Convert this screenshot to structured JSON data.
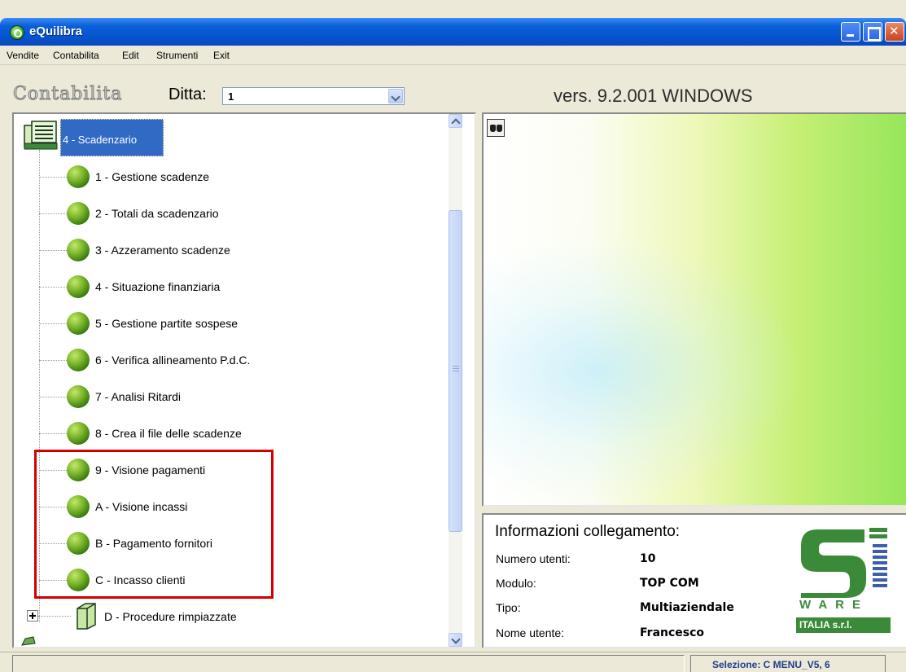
{
  "window": {
    "title": "eQuilibra"
  },
  "menu": [
    {
      "label": "Vendite"
    },
    {
      "label": "Contabilita"
    },
    {
      "label": "Edit"
    },
    {
      "label": "Strumenti"
    },
    {
      "label": "Exit"
    }
  ],
  "header": {
    "module_title": "Contabilita",
    "ditta_label": "Ditta:",
    "ditta_value": "1",
    "version": "vers. 9.2.001 WINDOWS"
  },
  "tree": {
    "root": {
      "label": "4 - Scadenzario",
      "icon": "menu-folder-icon"
    },
    "items": [
      {
        "label": "1 - Gestione scadenze"
      },
      {
        "label": "2 - Totali da scadenzario"
      },
      {
        "label": "3 - Azzeramento scadenze"
      },
      {
        "label": "4 - Situazione finanziaria"
      },
      {
        "label": "5 - Gestione partite sospese"
      },
      {
        "label": "6 - Verifica allineamento P.d.C."
      },
      {
        "label": "7 - Analisi Ritardi"
      },
      {
        "label": "8 - Crea il file delle scadenze"
      },
      {
        "label": "9 - Visione pagamenti"
      },
      {
        "label": "A - Visione incassi"
      },
      {
        "label": "B - Pagamento fornitori"
      },
      {
        "label": "C - Incasso clienti"
      }
    ],
    "subfolder": {
      "label": "D - Procedure rimpiazzate"
    }
  },
  "info": {
    "title": "Informazioni collegamento:",
    "rows": [
      {
        "label": "Numero utenti:",
        "value": "10"
      },
      {
        "label": "Modulo:",
        "value": "TOP COM"
      },
      {
        "label": "Tipo:",
        "value": "Multiaziendale"
      },
      {
        "label": "Nome utente:",
        "value": "Francesco"
      }
    ]
  },
  "logo": {
    "word": "WARE",
    "subtitle": "ITALIA s.r.l."
  },
  "status": {
    "selection": "Selezione: C MENU_V5, 6"
  },
  "colors": {
    "titlebar": "#0553d0",
    "selection": "#316ac5",
    "highlight_box": "#d40000",
    "accent_green": "#3a8a3a"
  }
}
